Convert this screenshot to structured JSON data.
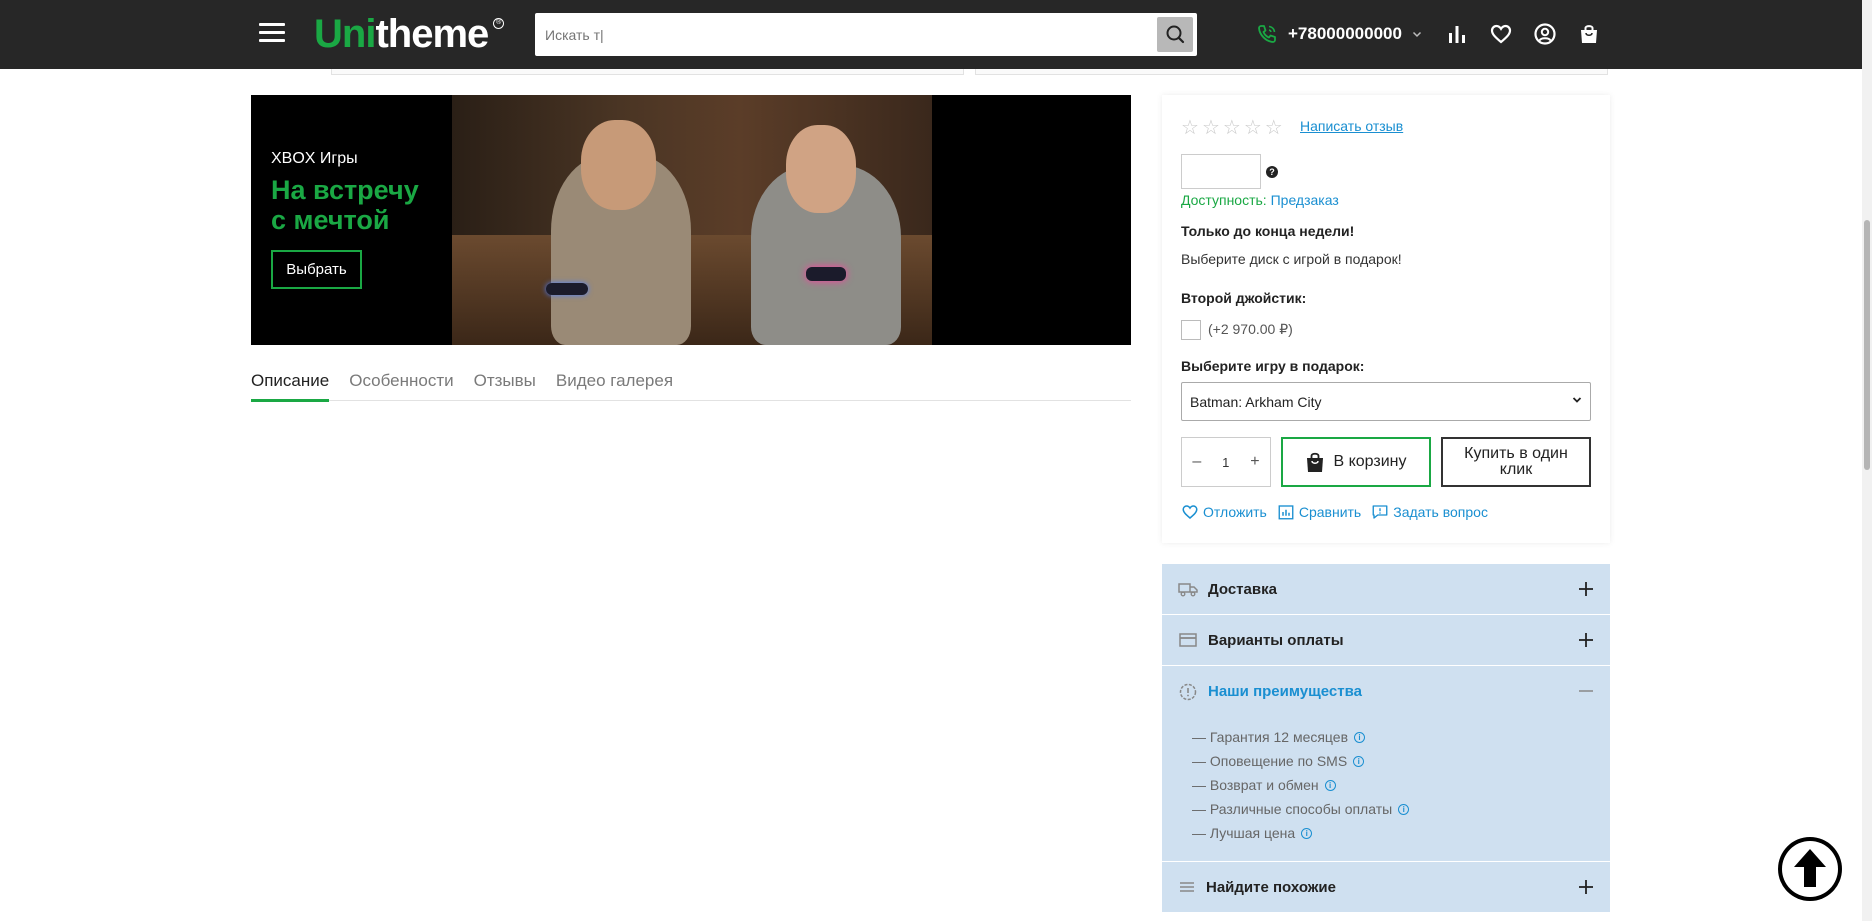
{
  "header": {
    "logo_part1": "Uni",
    "logo_part2": "theme",
    "search_placeholder": "Искать т|",
    "phone": "+78000000000"
  },
  "banner": {
    "subtitle": "XBOX Игры",
    "title": "На встречу с мечтой",
    "button": "Выбрать"
  },
  "tabs": [
    "Описание",
    "Особенности",
    "Отзывы",
    "Видео галерея"
  ],
  "product": {
    "write_review": "Написать отзыв",
    "availability_label": "Доступность:",
    "availability_value": "Предзаказ",
    "promo_title": "Только до конца недели!",
    "promo_text": "Выберите диск с игрой в подарок!",
    "joystick_title": "Второй джойстик:",
    "joystick_price": "(+2 970.00 ₽)",
    "game_title": "Выберите игру в подарок:",
    "game_selected": "Batman: Arkham City",
    "qty_minus": "–",
    "qty_value": "1",
    "qty_plus": "+",
    "cart_button": "В корзину",
    "oneclick_button": "Купить в один клик",
    "actions": {
      "wishlist": "Отложить",
      "compare": "Сравнить",
      "ask": "Задать вопрос"
    }
  },
  "accordion": {
    "delivery": "Доставка",
    "payment": "Варианты оплаты",
    "advantages": "Наши преимущества",
    "advantages_items": [
      "— Гарантия 12 месяцев",
      "— Оповещение по SMS",
      "— Возврат и обмен",
      "— Различные способы оплаты",
      "— Лучшая цена"
    ],
    "similar": "Найдите похожие"
  },
  "colors": {
    "brand_green": "#1aa844",
    "link_blue": "#1a8fd1",
    "header_bg": "#272727",
    "accordion_bg": "#cfe0f0"
  }
}
